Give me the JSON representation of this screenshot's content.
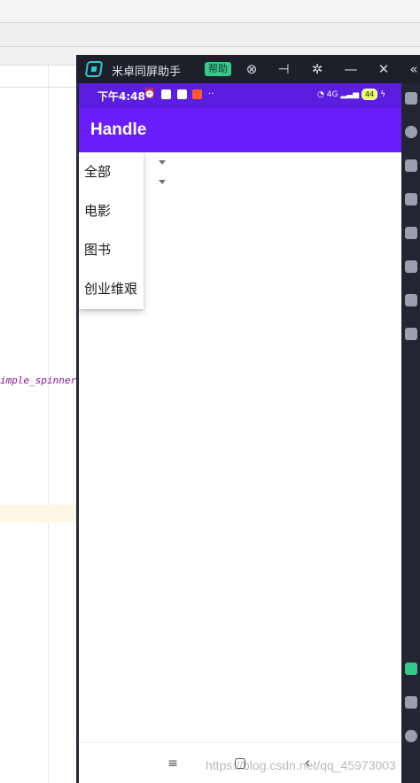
{
  "ide": {
    "code_fragment": "imple_spinner_"
  },
  "mirror": {
    "title": "米卓同屏助手",
    "help_label": "帮助",
    "icons": [
      "link-icon",
      "pin-icon",
      "gear-icon",
      "minimize-icon",
      "close-icon"
    ]
  },
  "phone": {
    "status": {
      "time": "下午4:48",
      "network": "4G",
      "battery": "44"
    },
    "app_bar": {
      "title": "Handle"
    },
    "dropdown": {
      "items": [
        "全部",
        "电影",
        "图书",
        "创业维艰"
      ]
    },
    "nav": {
      "menu_label": "≡",
      "back_label": "‹"
    }
  },
  "colors": {
    "status_bar": "#5b1ee0",
    "app_bar": "#6a1dfb",
    "mirror_titlebar": "#1d1f29",
    "help_badge": "#35c98a"
  },
  "watermark": "https://blog.csdn.net/qq_45973003"
}
